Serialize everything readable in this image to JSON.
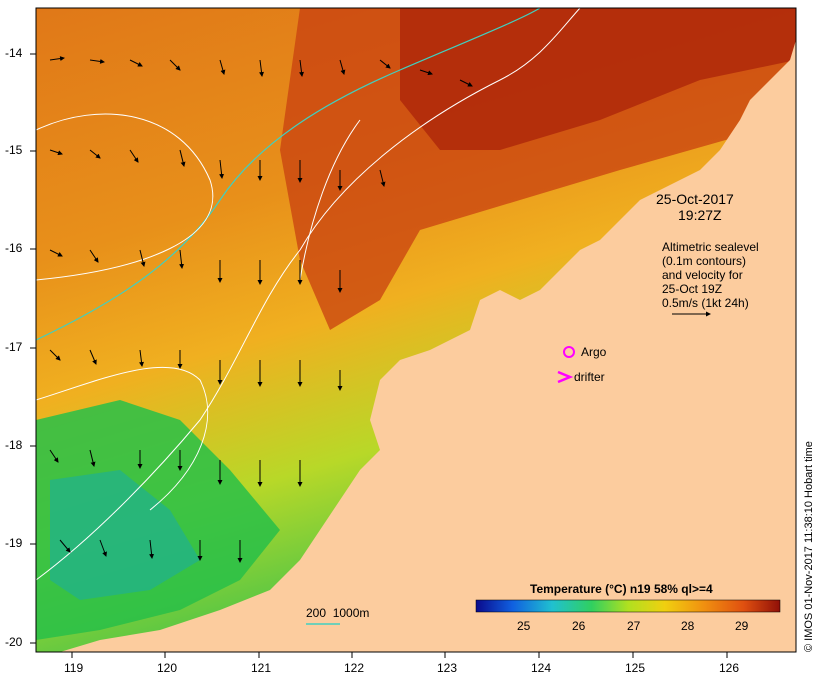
{
  "map": {
    "date": "25-Oct-2017",
    "time": "19:27Z",
    "altimetry_lines": [
      "Altimetric sealevel",
      "(0.1m contours)",
      "and velocity for",
      "25-Oct 19Z",
      "0.5m/s (1kt 24h)"
    ],
    "argo_label": "Argo",
    "drifter_label": "drifter",
    "bathy_label": "200  1000m",
    "footer": "© IMOS 01-Nov-2017 11:38:10 Hobart time",
    "lon_labels": [
      "119",
      "120",
      "121",
      "122",
      "123",
      "124",
      "125",
      "126"
    ],
    "lat_labels": [
      "-14",
      "-15",
      "-16",
      "-17",
      "-18",
      "-19",
      "-20"
    ],
    "colorbar": {
      "title": "Temperature (°C) n19 58% ql>=4",
      "ticks": [
        "25",
        "26",
        "27",
        "28",
        "29"
      ],
      "colors": [
        "#0a0a8c",
        "#1060e0",
        "#20c0d0",
        "#30d060",
        "#b0e020",
        "#f0d010",
        "#f09010",
        "#e05010",
        "#c02010",
        "#901008"
      ]
    },
    "colors": {
      "land": "#fccc9e",
      "warm": "#b82a0c",
      "mid": "#e88a12",
      "cool": "#50d040",
      "bathy": "#40d0c0",
      "argo": "#ff00ff"
    }
  }
}
